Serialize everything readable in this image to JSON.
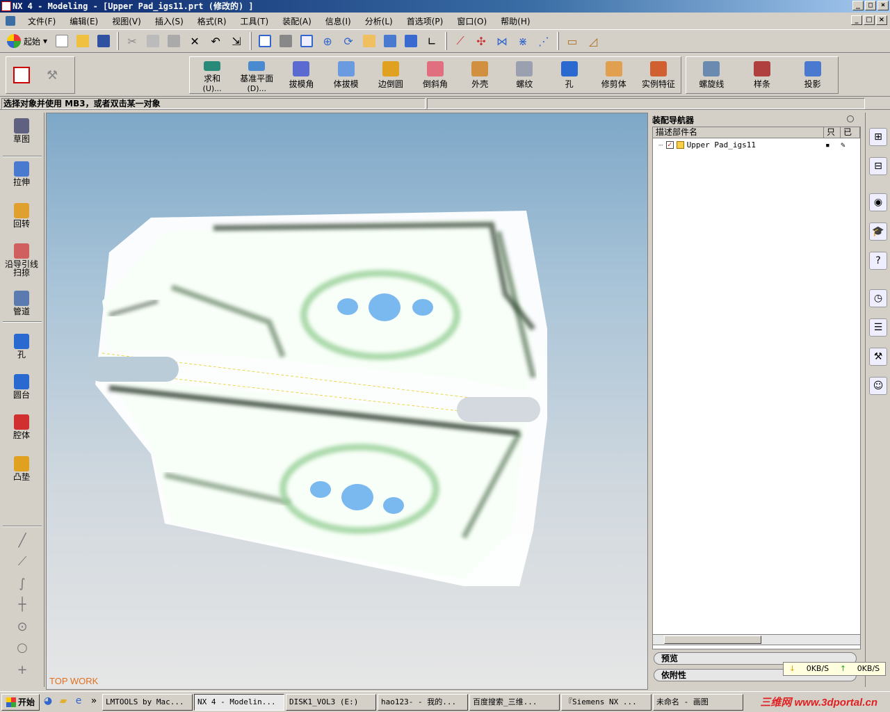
{
  "window": {
    "title": "NX 4 - Modeling - [Upper Pad_igs11.prt (修改的) ]"
  },
  "menu": [
    "文件(F)",
    "编辑(E)",
    "视图(V)",
    "插入(S)",
    "格式(R)",
    "工具(T)",
    "装配(A)",
    "信息(I)",
    "分析(L)",
    "首选项(P)",
    "窗口(O)",
    "帮助(H)"
  ],
  "toolbar": {
    "start_label": "起始"
  },
  "features": [
    {
      "label": "求和",
      "sub": "(U)...",
      "color": "#2a8a7a"
    },
    {
      "label": "基准平面",
      "sub": "(D)...",
      "color": "#4a8ad0"
    },
    {
      "label": "拔模角",
      "color": "#5a6ad0"
    },
    {
      "label": "体拔模",
      "color": "#6a9ae0"
    },
    {
      "label": "边倒圆",
      "color": "#e0a020"
    },
    {
      "label": "倒斜角",
      "color": "#e07080"
    },
    {
      "label": "外壳",
      "color": "#d09040"
    },
    {
      "label": "螺纹",
      "color": "#9aa0b0"
    },
    {
      "label": "孔",
      "color": "#2a6ad0"
    },
    {
      "label": "修剪体",
      "color": "#e0a050"
    },
    {
      "label": "实例特征",
      "color": "#d06030"
    }
  ],
  "features2": [
    {
      "label": "螺旋线",
      "color": "#6a8ab0"
    },
    {
      "label": "样条",
      "color": "#b04040"
    },
    {
      "label": "投影",
      "color": "#4a7ad0"
    }
  ],
  "cue_line": "选择对象并使用 MB3，或者双击某一对象",
  "resource_bar": [
    {
      "label": "草图",
      "color": "#606080"
    },
    {
      "label": "拉伸",
      "color": "#4a7ad0"
    },
    {
      "label": "回转",
      "color": "#e0a030"
    },
    {
      "label": "沿导引线\n扫掠",
      "color": "#d06060"
    },
    {
      "label": "管道",
      "color": "#5a7ab0"
    },
    {
      "label": "孔",
      "color": "#2a6ad0"
    },
    {
      "label": "圆台",
      "color": "#2a6ad0"
    },
    {
      "label": "腔体",
      "color": "#d03030"
    },
    {
      "label": "凸垫",
      "color": "#e0a020"
    }
  ],
  "viewport": {
    "label": "TOP WORK"
  },
  "navigator": {
    "title": "装配导航器",
    "col_name": "描述部件名",
    "col_a": "只",
    "col_b": "已",
    "part": "Upper Pad_igs11",
    "section_preview": "预览",
    "section_deps": "依附性"
  },
  "netmeter": {
    "down": "0KB/S",
    "up": "0KB/S"
  },
  "taskbar": {
    "start": "开始",
    "tasks": [
      "LMTOOLS by Mac...",
      "NX 4 - Modelin...",
      "DISK1_VOL3 (E:)",
      "hao123- - 我的...",
      "百度搜索_三维...",
      "『Siemens NX ...",
      "未命名 - 画图"
    ],
    "watermark": "三维网 www.3dportal.cn"
  }
}
